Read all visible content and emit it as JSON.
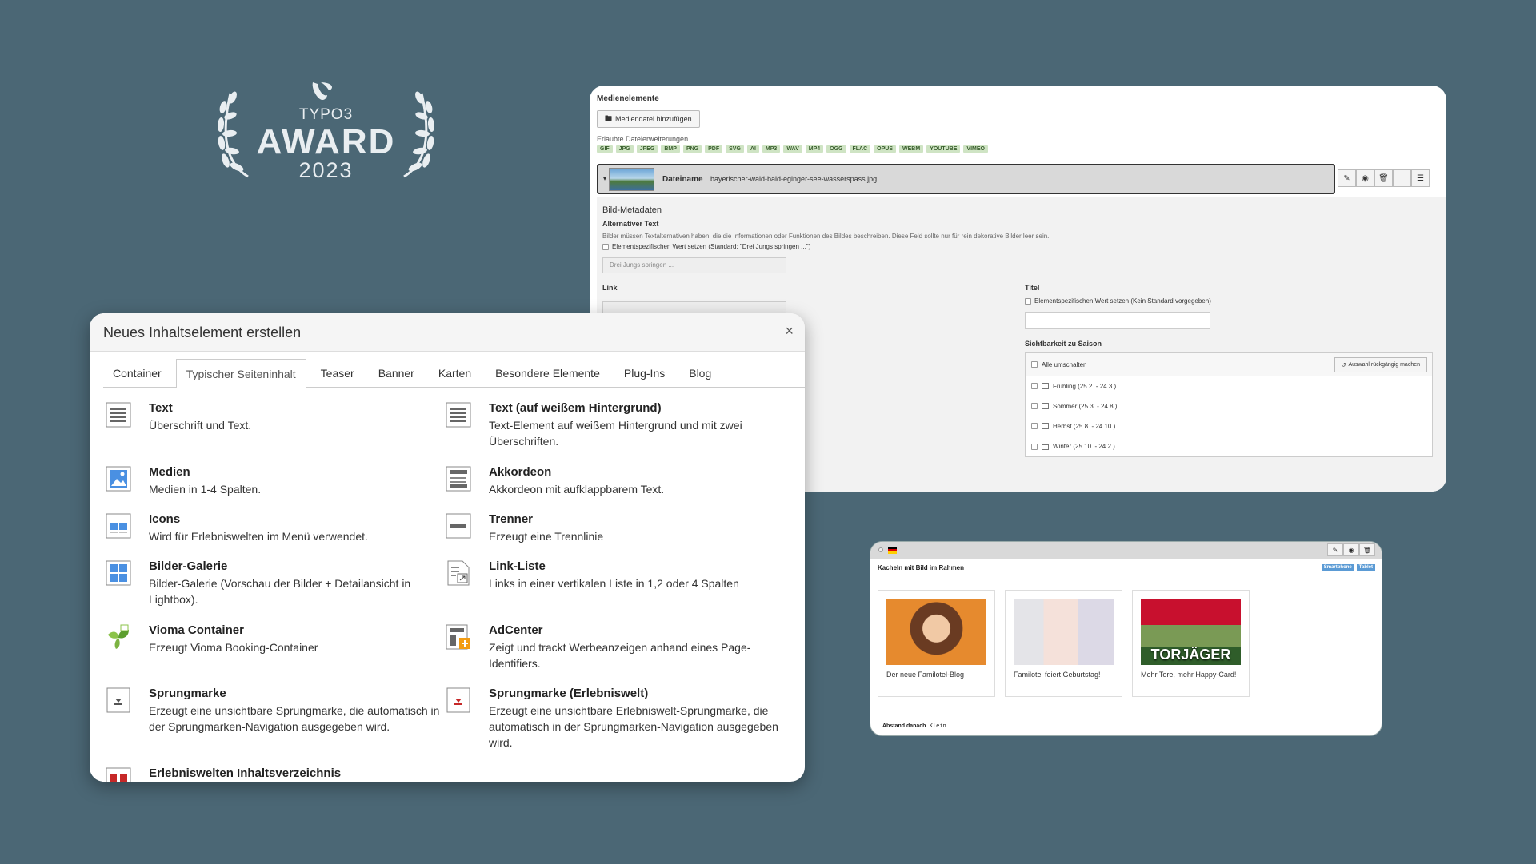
{
  "award": {
    "brand": "TYPO3",
    "title": "AWARD",
    "year": "2023"
  },
  "media_window": {
    "section_title": "Medienelemente",
    "add_button": "Mediendatei hinzufügen",
    "allowed_label": "Erlaubte Dateierweiterungen",
    "extensions": [
      "GIF",
      "JPG",
      "JPEG",
      "BMP",
      "PNG",
      "PDF",
      "SVG",
      "AI",
      "MP3",
      "WAV",
      "MP4",
      "OGG",
      "FLAC",
      "OPUS",
      "WEBM",
      "YOUTUBE",
      "VIMEO"
    ],
    "filename_label": "Dateiname",
    "filename_value": "bayerischer-wald-bald-eginger-see-wasserspass.jpg",
    "meta_title": "Bild-Metadaten",
    "alt_title": "Alternativer Text",
    "alt_desc": "Bilder müssen Textalternativen haben, die die Informationen oder Funktionen des Bildes beschreiben. Diese Feld sollte nur für rein dekorative Bilder leer sein.",
    "alt_check": "Elementspezifischen Wert setzen (Standard: \"Drei Jungs springen ...\")",
    "alt_placeholder": "Drei Jungs springen ...",
    "link_label": "Link",
    "title_label": "Titel",
    "title_check": "Elementspezifischen Wert setzen (Kein Standard vorgegeben)",
    "season_label": "Sichtbarkeit zu Saison",
    "season_toggle_all": "Alle umschalten",
    "season_reset": "Auswahl rückgängig machen",
    "seasons": [
      "Frühling (25.2. - 24.3.)",
      "Sommer (25.3. - 24.8.)",
      "Herbst (25.8. - 24.10.)",
      "Winter (25.10. - 24.2.)"
    ]
  },
  "tiles_window": {
    "title": "Kacheln mit Bild im Rahmen",
    "badges": [
      "Smartphone",
      "Tablet"
    ],
    "tiles": [
      {
        "caption": "Der neue Familotel-Blog"
      },
      {
        "caption": "Familotel feiert Geburtstag!"
      },
      {
        "caption": "Mehr Tore, mehr Happy-Card!",
        "image_text": "TORJÄGER"
      }
    ],
    "spacing_label": "Abstand danach",
    "spacing_value": "Klein"
  },
  "dialog": {
    "title": "Neues Inhaltselement erstellen",
    "close": "×",
    "tabs": [
      "Container",
      "Typischer Seiteninhalt",
      "Teaser",
      "Banner",
      "Karten",
      "Besondere Elemente",
      "Plug-Ins",
      "Blog"
    ],
    "active_tab": "Typischer Seiteninhalt",
    "elements": [
      {
        "name": "Text",
        "desc": "Überschrift und Text.",
        "icon": "text-icon"
      },
      {
        "name": "Text (auf weißem Hintergrund)",
        "desc": "Text-Element auf weißem Hintergrund und mit zwei Überschriften.",
        "icon": "text-icon"
      },
      {
        "name": "Medien",
        "desc": "Medien in 1-4 Spalten.",
        "icon": "image-icon"
      },
      {
        "name": "Akkordeon",
        "desc": "Akkordeon mit aufklappbarem Text.",
        "icon": "accordion-icon"
      },
      {
        "name": "Icons",
        "desc": "Wird für Erlebniswelten im Menü verwendet.",
        "icon": "icons-icon"
      },
      {
        "name": "Trenner",
        "desc": "Erzeugt eine Trennlinie",
        "icon": "divider-icon"
      },
      {
        "name": "Bilder-Galerie",
        "desc": "Bilder-Galerie (Vorschau der Bilder + Detailansicht in Lightbox).",
        "icon": "gallery-icon"
      },
      {
        "name": "Link-Liste",
        "desc": "Links in einer vertikalen Liste in 1,2 oder 4 Spalten",
        "icon": "link-list-icon"
      },
      {
        "name": "Vioma Container",
        "desc": "Erzeugt Vioma Booking-Container",
        "icon": "vioma-icon"
      },
      {
        "name": "AdCenter",
        "desc": "Zeigt und trackt Werbeanzeigen anhand eines Page-Identifiers.",
        "icon": "adcenter-icon"
      },
      {
        "name": "Sprungmarke",
        "desc": "Erzeugt eine unsichtbare Sprungmarke, die automatisch in der Sprungmarken-Navigation ausgegeben wird.",
        "icon": "anchor-icon"
      },
      {
        "name": "Sprungmarke (Erlebniswelt)",
        "desc": "Erzeugt eine unsichtbare Erlebniswelt-Sprungmarke, die automatisch in der Sprungmarken-Navigation ausgegeben wird.",
        "icon": "anchor-red-icon"
      },
      {
        "name": "Erlebniswelten Inhaltsverzeichnis",
        "desc": "",
        "icon": "toc-icon"
      }
    ]
  }
}
